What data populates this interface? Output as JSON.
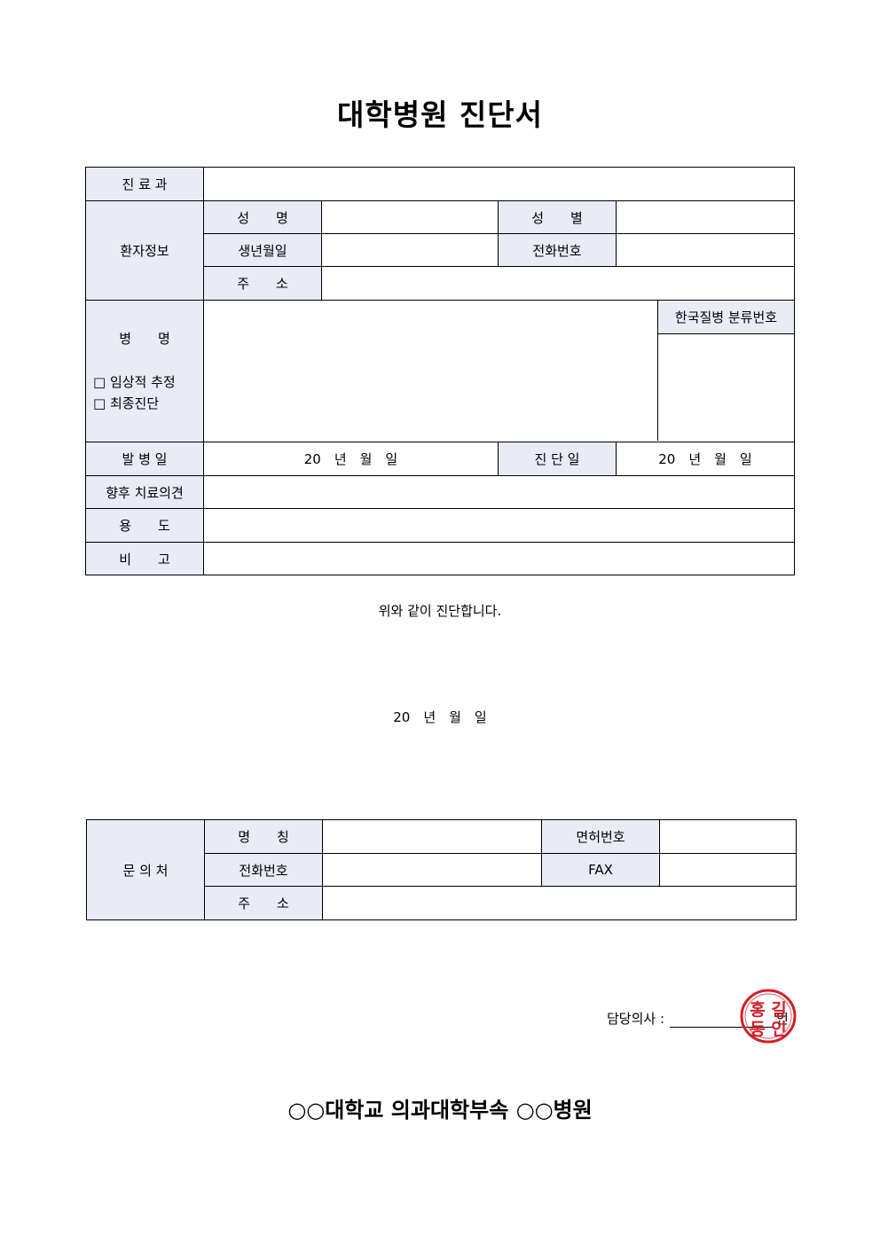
{
  "title": "대학병원 진단서",
  "main": {
    "dept_label": "진 료 과",
    "patient_label": "환자정보",
    "name_label": "성　　명",
    "sex_label": "성　　별",
    "birth_label": "생년월일",
    "phone_label": "전화번호",
    "address_label": "주　　소",
    "diagnosis_label": "병　　명",
    "clinical_option": "□ 임상적 추정",
    "final_option": "□ 최종진단",
    "kcd_label": "한국질병 분류번호",
    "onset_label": "발 병 일",
    "onset_value": "20　년　월　일",
    "diag_date_label": "진 단 일",
    "diag_date_value": "20　년　월　일",
    "opinion_label": "향후 치료의견",
    "purpose_label": "용　　도",
    "remarks_label": "비　　고"
  },
  "statement": "위와 같이 진단합니다.",
  "date_line": "20　년　월　일",
  "contact": {
    "inquiry_label": "문 의 처",
    "name_label": "명　　칭",
    "license_label": "면허번호",
    "phone_label": "전화번호",
    "fax_label": "FAX",
    "address_label": "주　　소"
  },
  "doctor": {
    "label": "담당의사 :",
    "seal_mark": "인",
    "seal_text": "홍길동인"
  },
  "footer": "○○대학교 의과대학부속 ○○병원"
}
